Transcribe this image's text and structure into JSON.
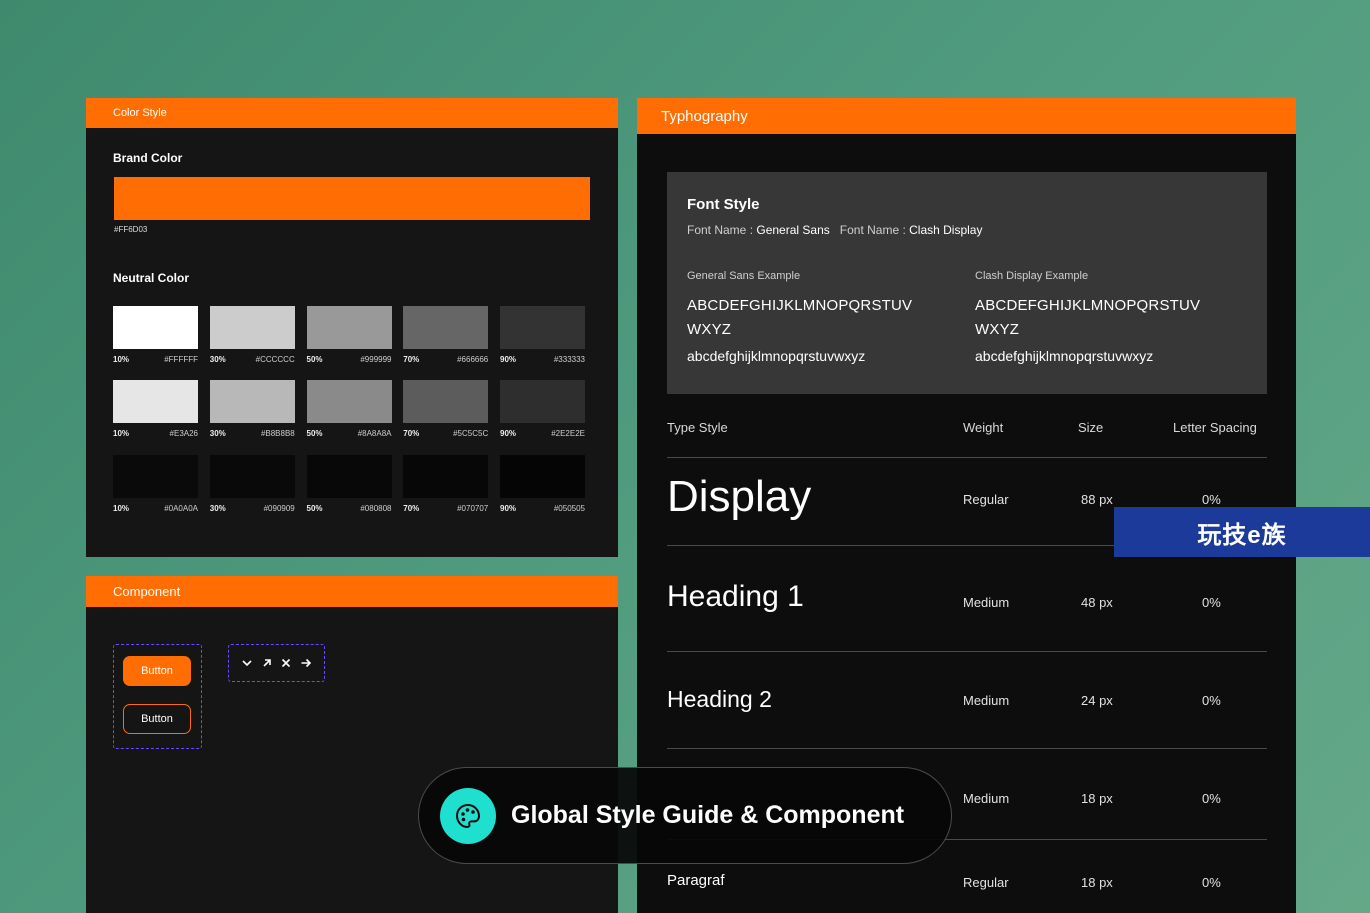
{
  "colors": {
    "accent": "#FF6D03",
    "overlay_badge": "#1C3A9A",
    "pill_icon_bg": "#1FE0CF",
    "dashed_outline": "#6B4BFF"
  },
  "color_style": {
    "title": "Color Style",
    "brand_label": "Brand Color",
    "brand_hex": "#FF6D03",
    "neutral_label": "Neutral Color",
    "swatch_rows": [
      [
        {
          "pct": "10%",
          "hex": "#FFFFFF"
        },
        {
          "pct": "30%",
          "hex": "#CCCCCC"
        },
        {
          "pct": "50%",
          "hex": "#999999"
        },
        {
          "pct": "70%",
          "hex": "#666666"
        },
        {
          "pct": "90%",
          "hex": "#333333"
        }
      ],
      [
        {
          "pct": "10%",
          "hex": "#E3A26",
          "color": "#E6E6E6"
        },
        {
          "pct": "30%",
          "hex": "#B8B8B8"
        },
        {
          "pct": "50%",
          "hex": "#8A8A8A"
        },
        {
          "pct": "70%",
          "hex": "#5C5C5C"
        },
        {
          "pct": "90%",
          "hex": "#2E2E2E"
        }
      ],
      [
        {
          "pct": "10%",
          "hex": "#0A0A0A"
        },
        {
          "pct": "30%",
          "hex": "#090909"
        },
        {
          "pct": "50%",
          "hex": "#080808"
        },
        {
          "pct": "70%",
          "hex": "#070707"
        },
        {
          "pct": "90%",
          "hex": "#050505"
        }
      ]
    ]
  },
  "component": {
    "title": "Component",
    "primary_button": "Button",
    "outline_button": "Button",
    "icons": [
      "chevron-down-icon",
      "arrow-up-right-icon",
      "close-icon",
      "arrow-right-icon"
    ]
  },
  "typography": {
    "title": "Typhography",
    "font_style_title": "Font Style",
    "font_name_label_1": "Font Name : ",
    "font_name_1": "General Sans",
    "font_name_label_2": "Font Name : ",
    "font_name_2": "Clash Display",
    "example_1": {
      "label": "General Sans Example",
      "upper_1": "ABCDEFGHIJKLMNOPQRSTUV",
      "upper_2": "WXYZ",
      "lower": "abcdefghijklmnopqrstuvwxyz"
    },
    "example_2": {
      "label": "Clash Display Example",
      "upper_1": "ABCDEFGHIJKLMNOPQRSTUV",
      "upper_2": "WXYZ",
      "lower": "abcdefghijklmnopqrstuvwxyz"
    },
    "table_headers": {
      "type_style": "Type Style",
      "weight": "Weight",
      "size": "Size",
      "letter_spacing": "Letter Spacing"
    },
    "rows": [
      {
        "name": "Display",
        "weight": "Regular",
        "size": "88 px",
        "spacing": "0%"
      },
      {
        "name": "Heading 1",
        "weight": "Medium",
        "size": "48 px",
        "spacing": "0%"
      },
      {
        "name": "Heading 2",
        "weight": "Medium",
        "size": "24 px",
        "spacing": "0%"
      },
      {
        "name": "",
        "weight": "Medium",
        "size": "18 px",
        "spacing": "0%"
      },
      {
        "name": "Paragraf",
        "weight": "Regular",
        "size": "18 px",
        "spacing": "0%"
      }
    ]
  },
  "overlay": {
    "watermark": "玩技e族",
    "pill_text": "Global Style Guide & Component",
    "pill_icon": "palette-icon"
  }
}
